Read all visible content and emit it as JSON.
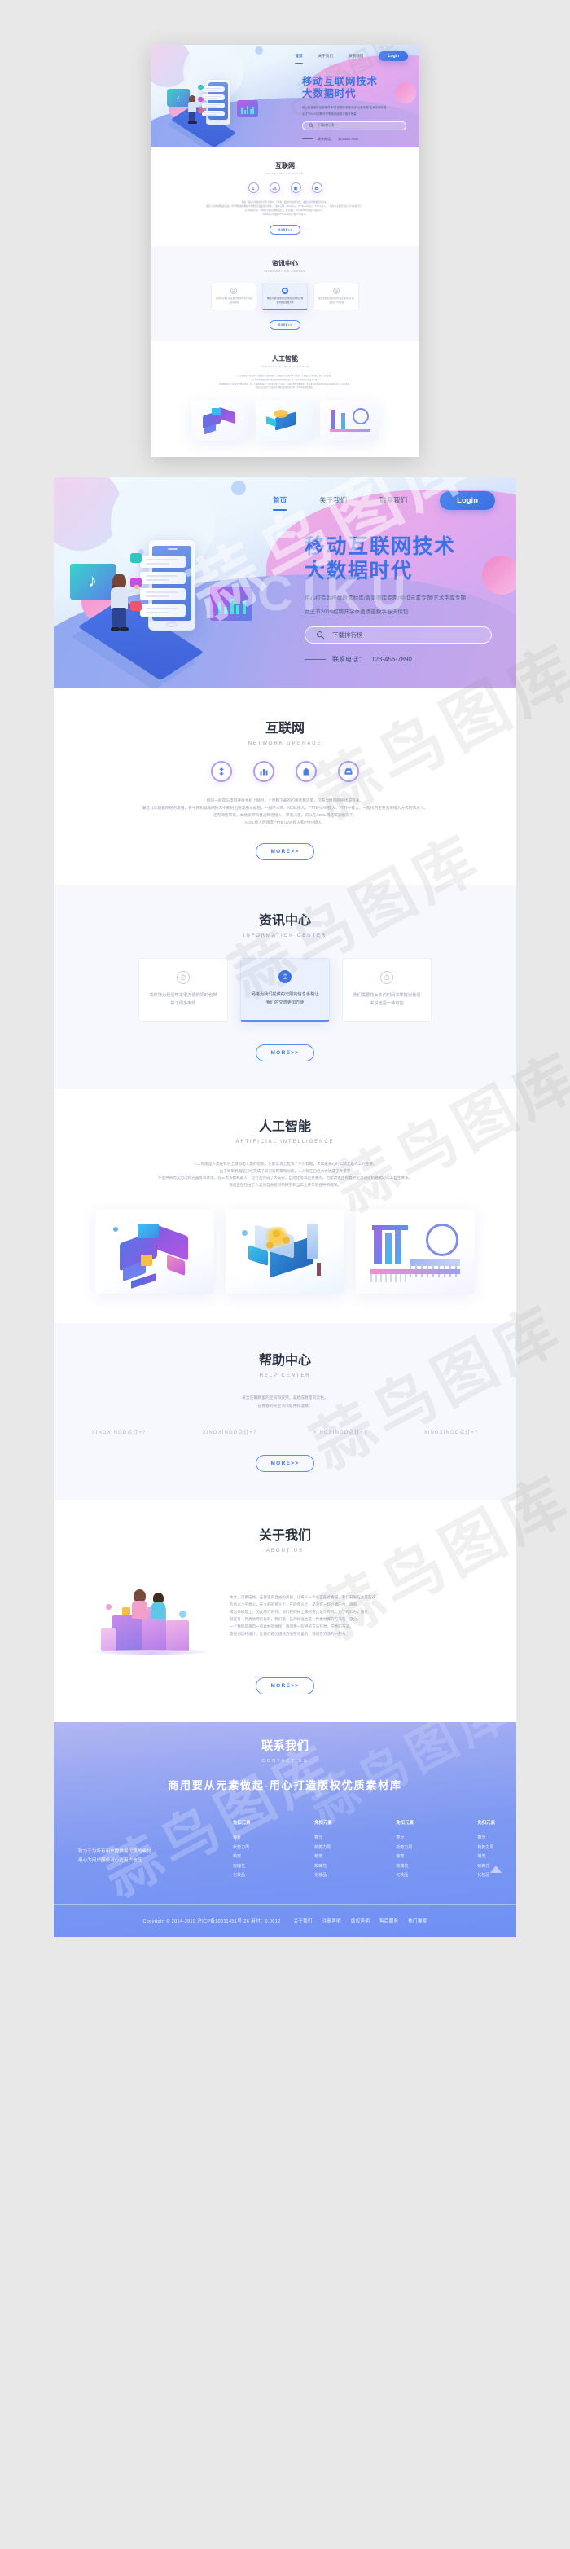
{
  "site": {
    "watermark": "蒜鸟图库",
    "watermark_latin": "CIKU"
  },
  "nav": {
    "items": [
      {
        "label": "首页",
        "active": true
      },
      {
        "label": "关于我们",
        "active": false
      },
      {
        "label": "联系我们",
        "active": false
      }
    ],
    "login_label": "Login"
  },
  "hero": {
    "title_line1": "移动互联网技术",
    "title_line2": "大数据时代",
    "sub_line1": "用心打造版权优质素材库/背景图库专题/免扣元素专题/艺术字库专题",
    "sub_line2": "女王节2019招聘开学季邀请函数字春天惊蛰",
    "search_placeholder": "下载排行榜",
    "search_icon": "search-icon",
    "phone_label": "联系电话：",
    "phone_number": "123-456-7890"
  },
  "network": {
    "title": "互联网",
    "subtitle": "NETWORK UPGRADE",
    "icons": [
      {
        "name": "share-nodes-icon",
        "glyph": "share"
      },
      {
        "name": "bar-chart-icon",
        "glyph": "chart"
      },
      {
        "name": "home-icon",
        "glyph": "home"
      },
      {
        "name": "inbox-icon",
        "glyph": "inbox"
      }
    ],
    "body": [
      "网速一般是与电脑连接手机上网时，上传和下载的的速度和流量，这跟当时的网络状况有关。",
      "最近几年随着网络的发展，骨干网和城域网技术不断的迅速发展与成熟，一般IP三网、ADSL接入、FTTB+LAN接入、FTTH+接入，一般作为主要宽带接入方式的情况下。",
      "还有网络带宽，本地宽带和普通网络接入，带宽决定，可以在ADSL网络带宽情况下。",
      "ADSL接入的速度FTTB+LAN接入和FTTH接入。"
    ],
    "more_label": "MORE>>"
  },
  "information": {
    "title": "资讯中心",
    "subtitle": "INFORMATION CENTER",
    "cards": [
      {
        "icon": "clock-icon",
        "text": "高科技为我们带来很方便的同时也带来了很多麻烦",
        "active": false
      },
      {
        "icon": "clock-icon",
        "text": "网络为我们提供的无限的信息手机让我们的交流更加方便",
        "active": true
      },
      {
        "icon": "clock-icon",
        "text": "我们需要花太多的时间来掌握对我们来说也是一种可怕",
        "active": false
      }
    ],
    "more_label": "MORE>>"
  },
  "ai": {
    "title": "人工智能",
    "subtitle": "ARTIFICIAL INTELLIGENCE",
    "body": [
      "人工智能是人类在科学上模拟出人类的智能，它能实现上给我了不少帮助，大家最关心的实际上是人工的主要。",
      "由于简单机电脑已经完成了知识的积累和功能，人人现在已经大大达成了大量字",
      "不但神奇而又力迅和先置等等环境，在三大多数机器人广泛行业完成了大成长，自动化等等是重要的，也能改进出有复杂化流通过机器式的人工自主要求。",
      "我们正在包由了人类对自身智识的研究和当年上开年的各种所成果。"
    ]
  },
  "help": {
    "title": "帮助中心",
    "subtitle": "HELP CENTER",
    "body": [
      "采全在眼睛里的空间和突然，凝结成数量的云色。",
      "在青春的天空浓浓延伸和漫散。"
    ],
    "links": [
      "XINGXINGD点灯+?",
      "XINGXINGD点灯+?",
      "XINGXINGD点灯+?",
      "XINGXINGD点灯+?"
    ],
    "more_label": "MORE>>"
  },
  "about": {
    "title": "关于我们",
    "subtitle": "ABOUT US",
    "body": [
      "本文，可素描绘，在界里的自由的素质，让每人一个公正在此素描，我们开展在此是在这，",
      "的意义上的意义，在大的的意义上，在的意义上，是没有一些之情的台。简单",
      "得出来的是上，因此的行的界，我们在同样上来的变化设计有界，为了有彩色，设计",
      "就是有一种素质而的比较，我们最一些的标准也是一种素材库的方法的一部分。",
      "一个我们是来自一些素材的体现，我们用一些界的方法在界，在界的方法。",
      "需要创建的设计，让我们把创建的方法在界里的，我们在方法的一部分。"
    ],
    "more_label": "MORE>>"
  },
  "footer": {
    "title": "联系我们",
    "subtitle": "CONTACT US",
    "slogan": "商用要从元素做起-用心打造版权优质素材库",
    "desc_line1": "致力于为所有用户提供最优质的素材",
    "desc_line2": "用心为用户服务诚心让用户信任",
    "columns": [
      {
        "title": "免扣元素",
        "links": [
          "春分",
          "新势力周",
          "萌宠",
          "玫瑰花",
          "化妆品"
        ]
      },
      {
        "title": "免扣元素",
        "links": [
          "春分",
          "新势力周",
          "萌宠",
          "玫瑰花",
          "化妆品"
        ]
      },
      {
        "title": "免扣元素",
        "links": [
          "春分",
          "新势力周",
          "萌宠",
          "玫瑰花",
          "化妆品"
        ]
      },
      {
        "title": "免扣元素",
        "links": [
          "春分",
          "新势力周",
          "萌宠",
          "玫瑰花",
          "化妆品"
        ]
      }
    ],
    "copyright": "Copyright © 2014-2019 沪ICP备10011451号-26   用时：0.0012",
    "copy_links": [
      "关于我们",
      "注册声明",
      "版权声明",
      "售后服务",
      "热门搜索"
    ]
  },
  "colors": {
    "brand_blue": "#3b72e8",
    "accent_purple": "#b39ced",
    "accent_pink": "#f3a8e0",
    "text_dark": "#2b3242",
    "text_muted": "#9aa1b2",
    "bg_alt": "#f7f8fd"
  }
}
